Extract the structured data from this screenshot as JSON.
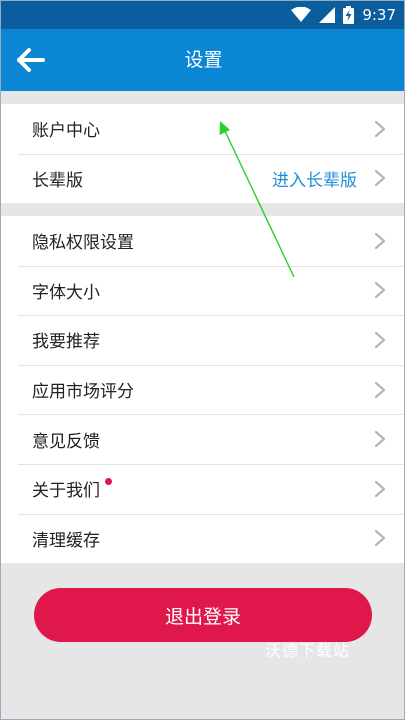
{
  "status_bar": {
    "time": "9:37",
    "icons": [
      "wifi-icon",
      "signal-icon",
      "battery-charging-icon"
    ]
  },
  "header": {
    "title": "设置",
    "back_icon": "back-arrow-icon"
  },
  "settings": {
    "group1": [
      {
        "label": "账户中心",
        "value": ""
      },
      {
        "label": "长辈版",
        "value": "进入长辈版"
      }
    ],
    "group2": [
      {
        "label": "隐私权限设置"
      },
      {
        "label": "字体大小"
      },
      {
        "label": "我要推荐"
      },
      {
        "label": "应用市场评分"
      },
      {
        "label": "意见反馈"
      },
      {
        "label": "关于我们",
        "badge": "red-dot"
      },
      {
        "label": "清理缓存"
      }
    ]
  },
  "logout": {
    "label": "退出登录"
  },
  "watermark": {
    "text": "沃德下载站"
  },
  "colors": {
    "status_bar": "#0a5e9e",
    "header": "#0b86d4",
    "accent_link": "#1e8fd6",
    "logout": "#e0174b",
    "background": "#e6e6e6",
    "annotation_arrow": "#2bd12b"
  }
}
